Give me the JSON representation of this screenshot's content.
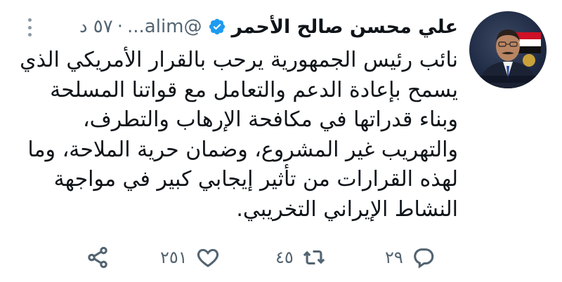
{
  "author": {
    "name": "علي محسن صالح الأحمر",
    "handle": "@alim...",
    "time": "٥٧ د",
    "separator": "·"
  },
  "tweet": {
    "lines": [
      "نائب رئيس  الجمهورية يرحب بالقرار الأمريكي الذي",
      "يسمح بإعادة الدعم والتعامل مع قواتنا المسلحة",
      "وبناء قدراتها في مكافحة الإرهاب والتطرف،",
      "والتهريب غير المشروع، وضمان حرية الملاحة، وما",
      "لهذه القرارات من تأثير إيجابي كبير في مواجهة",
      "النشاط الإيراني التخريبي."
    ]
  },
  "actions": {
    "reply_count": "٢٩",
    "retweet_count": "٤٥",
    "like_count": "٢٥١"
  },
  "icons": {
    "verified": "verified-badge-icon",
    "more": "more-icon",
    "reply": "reply-icon",
    "retweet": "retweet-icon",
    "like": "heart-icon",
    "share": "share-icon"
  },
  "colors": {
    "verified": "#1d9bf0",
    "muted": "#536471"
  }
}
